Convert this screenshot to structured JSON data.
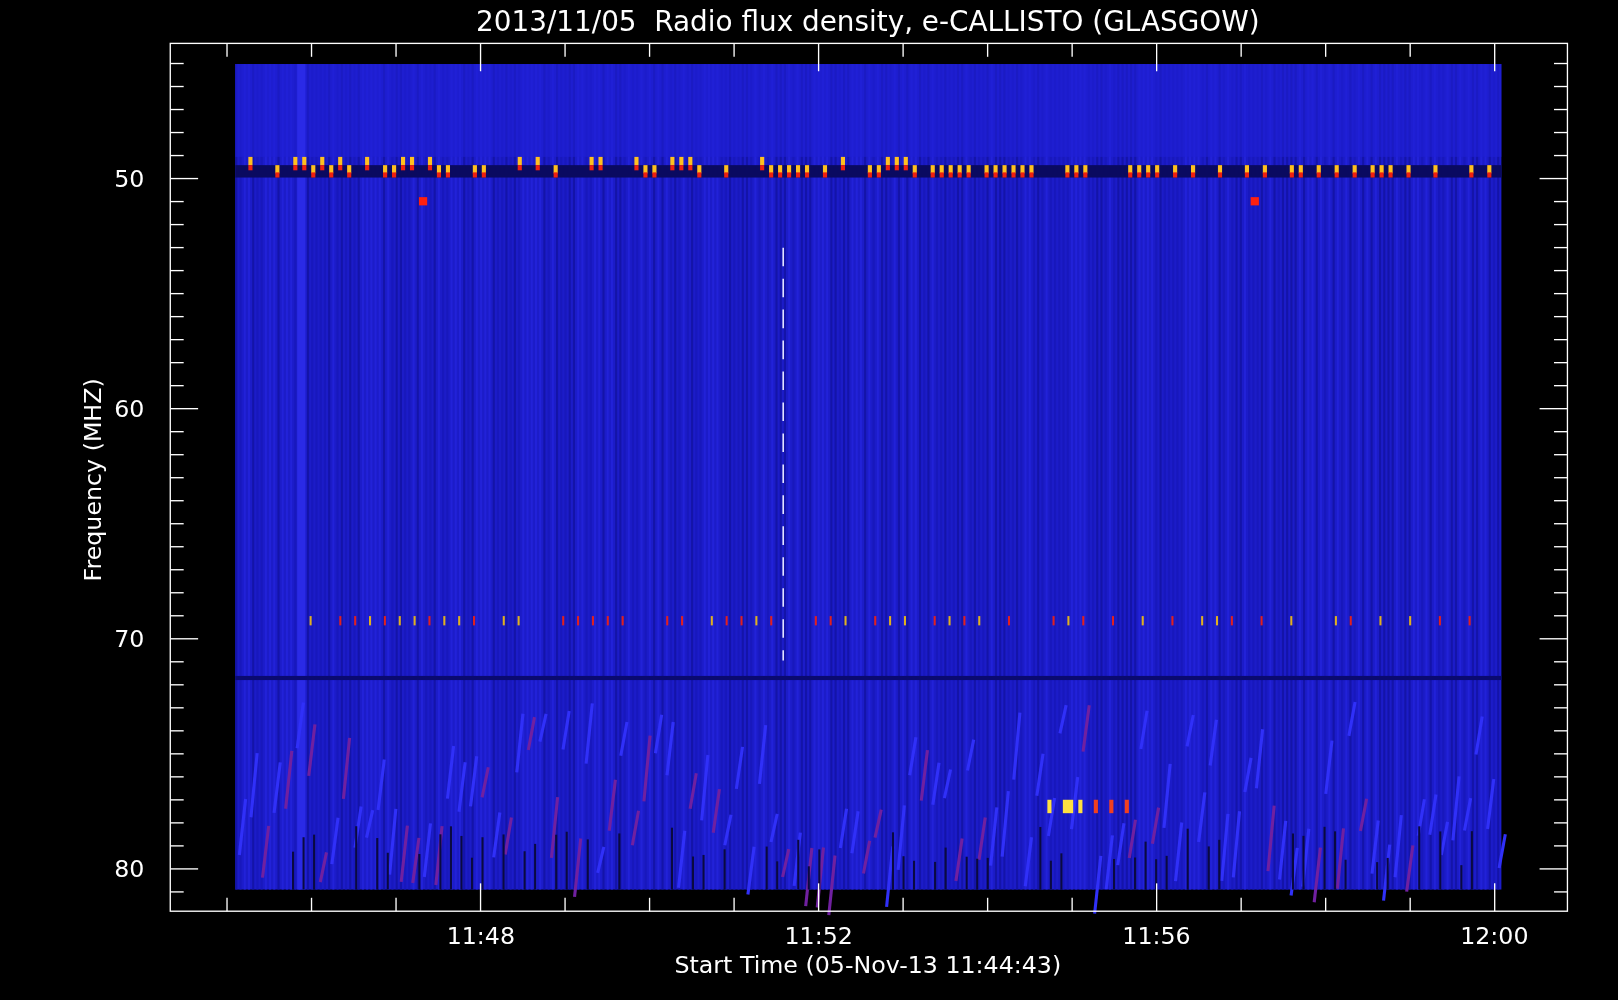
{
  "title": "2013/11/05  Radio flux density, e-CALLISTO (GLASGOW)",
  "y_axis": {
    "label": "Frequency (MHZ)",
    "tick_labels": [
      "50",
      "60",
      "70",
      "80"
    ]
  },
  "x_axis": {
    "label": "Start Time (05-Nov-13 11:44:43)",
    "tick_labels": [
      "11:48",
      "11:52",
      "11:56",
      "12:00"
    ]
  }
}
